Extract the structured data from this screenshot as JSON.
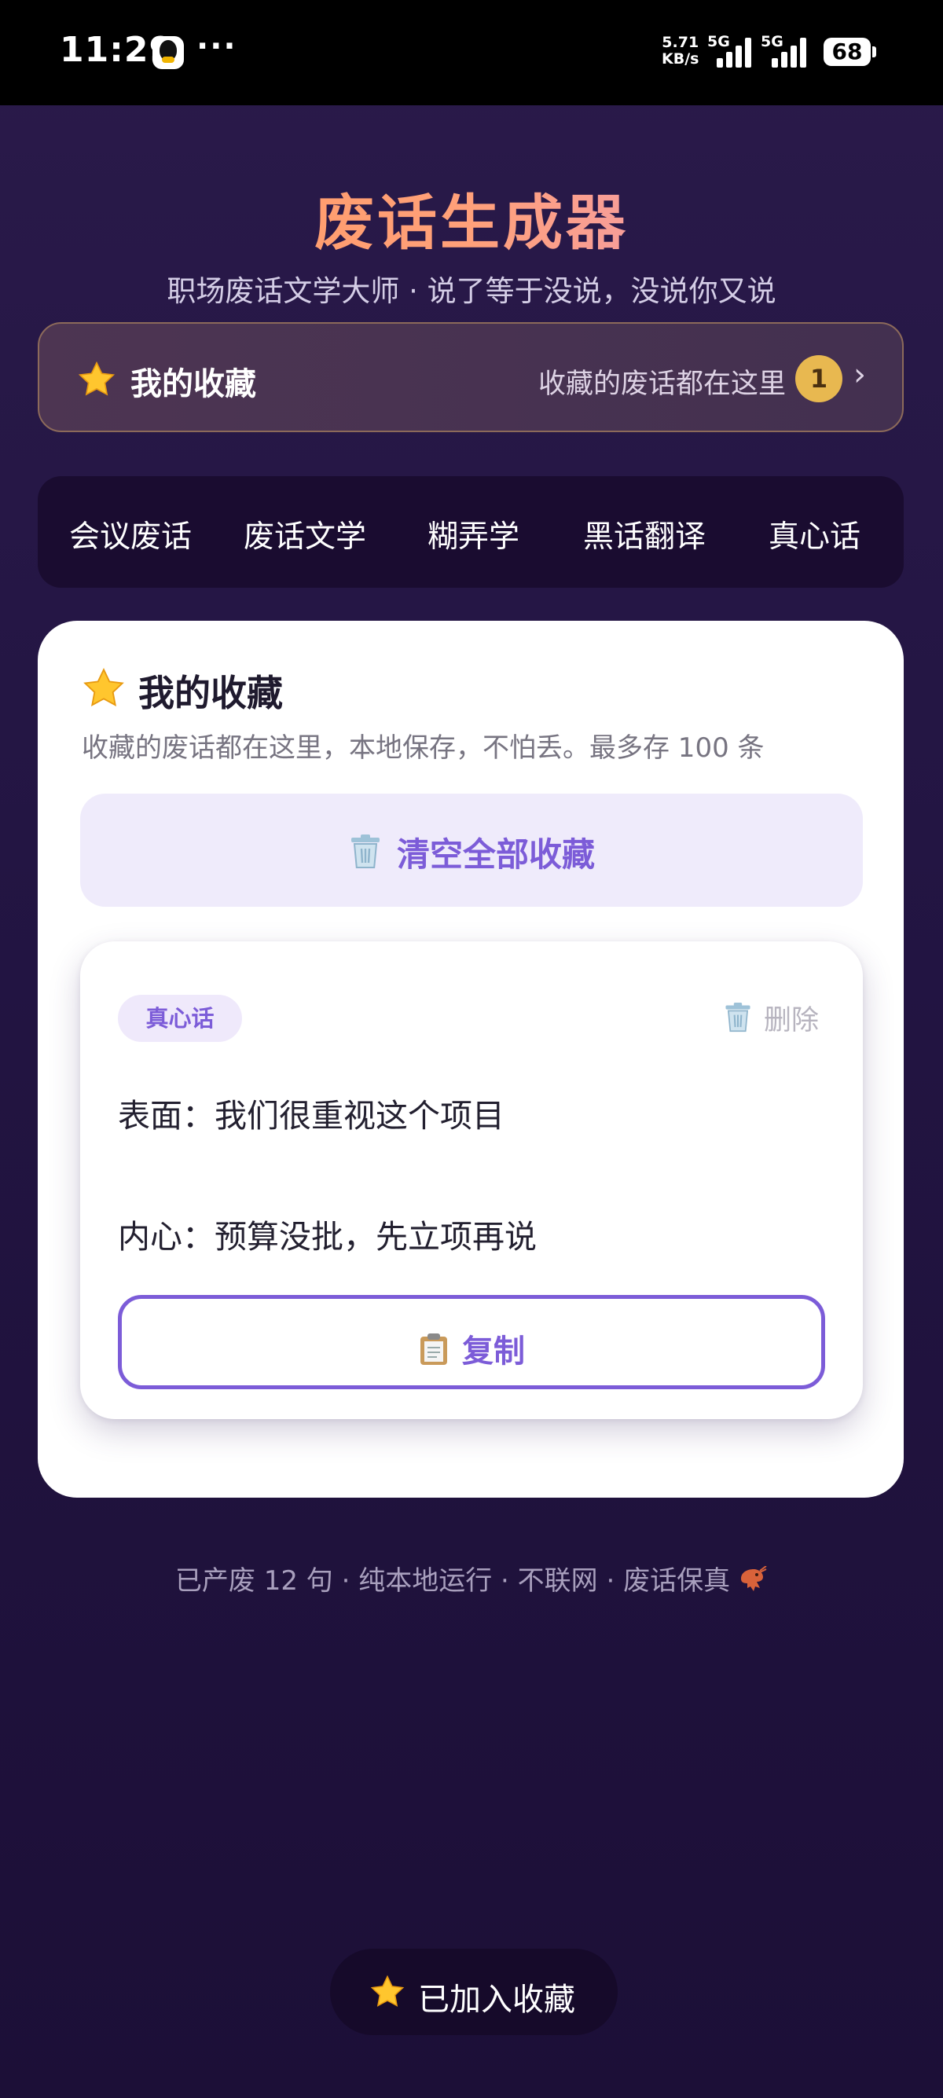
{
  "status_bar": {
    "time": "11:29",
    "dots": "···",
    "net_speed_value": "5.71",
    "net_speed_unit": "KB/s",
    "sim1": "5G",
    "sim2": "5G",
    "battery": "68"
  },
  "header": {
    "title": "废话生成器",
    "subtitle": "职场废话文学大师 · 说了等于没说，没说你又说"
  },
  "favorites_banner": {
    "label": "我的收藏",
    "hint": "收藏的废话都在这里",
    "count": "1",
    "chevron": "›"
  },
  "tabs": [
    {
      "label": "会议废话"
    },
    {
      "label": "废话文学"
    },
    {
      "label": "糊弄学"
    },
    {
      "label": "黑话翻译"
    },
    {
      "label": "真心话"
    }
  ],
  "card": {
    "title": "我的收藏",
    "description": "收藏的废话都在这里，本地保存，不怕丢。最多存 100 条",
    "clear_button": "清空全部收藏"
  },
  "favorite_item": {
    "tag": "真心话",
    "delete_label": "删除",
    "surface_line": "表面：我们很重视这个项目",
    "inner_line": "内心：预算没批，先立项再说",
    "copy_label": "复制"
  },
  "footer": "已产废 12 句 · 纯本地运行 · 不联网 · 废话保真",
  "toast": "已加入收藏",
  "colors": {
    "accent": "#7c5cd8",
    "badge": "#e8b850",
    "background": "#231543"
  },
  "icons": [
    "star-icon",
    "trash-icon",
    "clipboard-icon",
    "shrimp-icon",
    "chevron-right-icon"
  ]
}
